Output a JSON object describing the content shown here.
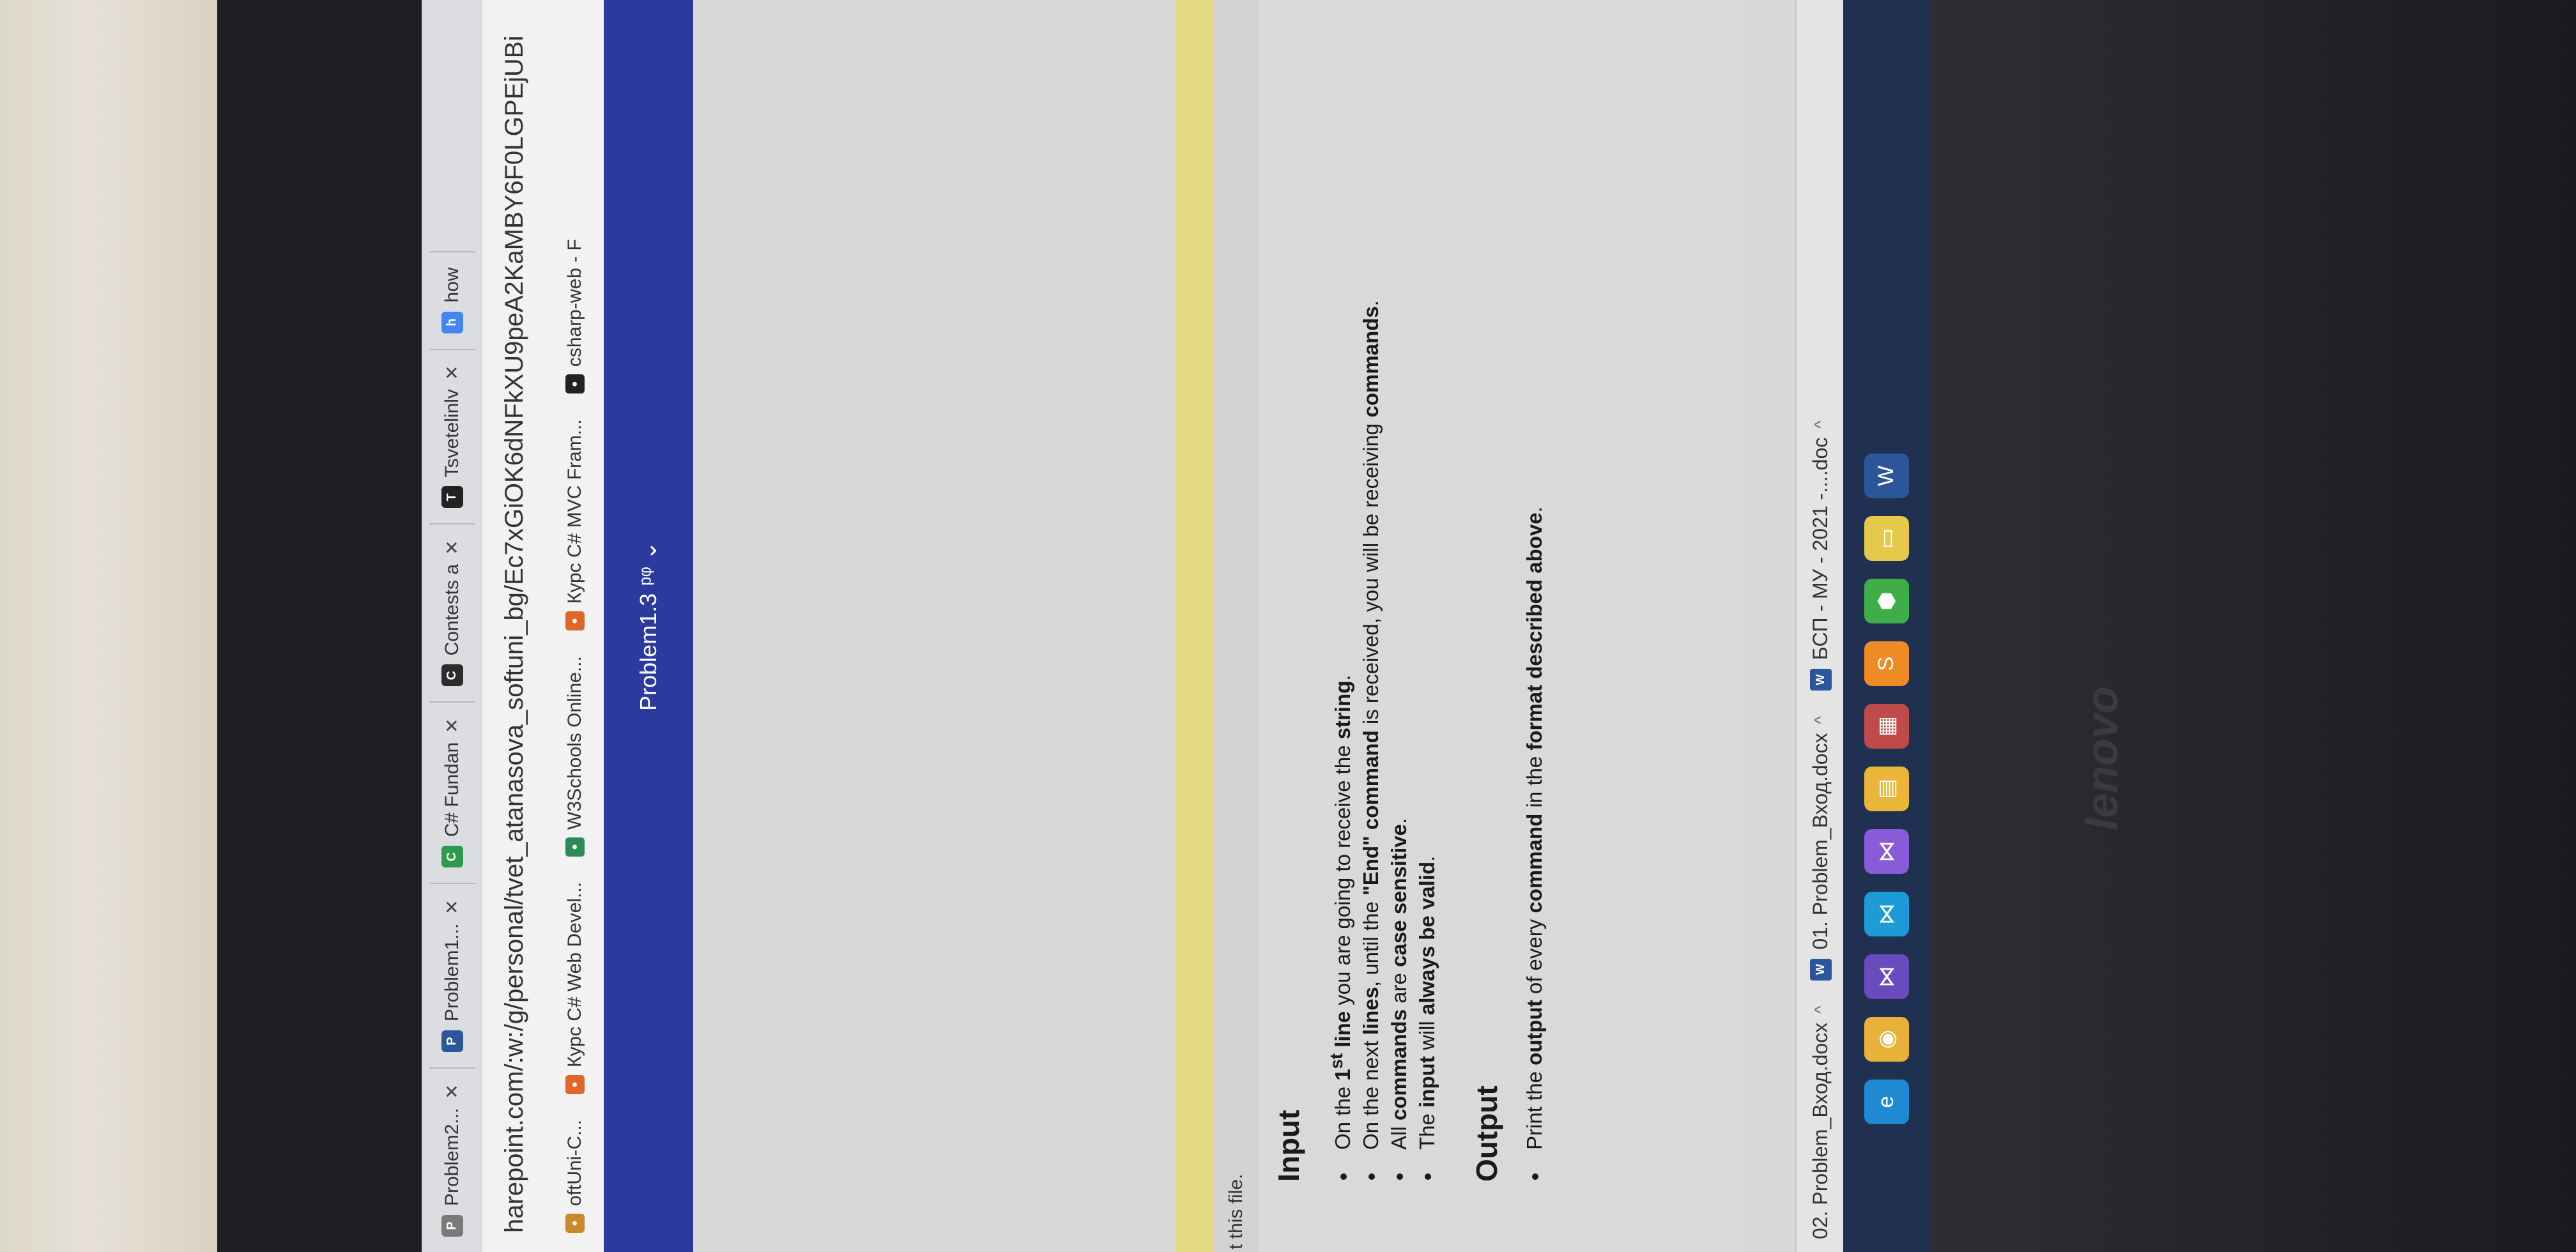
{
  "browser": {
    "tabs": [
      {
        "label": "Problem2...",
        "icon": "document-icon",
        "color": "#7a7a7a"
      },
      {
        "label": "Problem1...",
        "icon": "word-icon",
        "color": "#2b579a"
      },
      {
        "label": "C# Fundan",
        "icon": "softuni-icon",
        "color": "#2e9b4a"
      },
      {
        "label": "Contests a",
        "icon": "judge-icon",
        "color": "#2c2c2c"
      },
      {
        "label": "Tsvetelinlv",
        "icon": "github-icon",
        "color": "#222222"
      },
      {
        "label": "how",
        "icon": "google-icon",
        "color": "#4285f4"
      }
    ],
    "tab_close": "✕",
    "address": "harepoint.com/:w:/g/personal/tvet_atanasova_softuni_bg/Ec7xGiOK6dNFkXU9peA2KaMBY6F0LGPEjUBi",
    "bookmarks": [
      {
        "label": "oftUni-C...",
        "icon": "folder-icon",
        "color": "#c98a2b"
      },
      {
        "label": "Курс C# Web Devel...",
        "icon": "softuni-icon",
        "color": "#e0672a"
      },
      {
        "label": "W3Schools Online...",
        "icon": "w3schools-icon",
        "color": "#2e8b57"
      },
      {
        "label": "Курс C# MVC Fram...",
        "icon": "softuni-icon",
        "color": "#e0672a"
      },
      {
        "label": "csharp-web - F",
        "icon": "github-icon",
        "color": "#222222"
      }
    ]
  },
  "word": {
    "doc_title": "Problem1.3",
    "title_suffix": "ᵖᵠ ⌄"
  },
  "document": {
    "partial_line": "t this file.",
    "input_heading": "Input",
    "input_items": [
      "On the 1st line you are going to receive the string.",
      "On the next lines, until the \"End\" command is received, you will be receiving commands.",
      "All commands are case sensitive.",
      "The input will always be valid."
    ],
    "output_heading": "Output",
    "output_items": [
      "Print the output of every command in the format described above."
    ]
  },
  "downloads": [
    {
      "label": "02. Problem_Вход.docx",
      "chevron": "^"
    },
    {
      "label": "01. Problem_Вход.docx",
      "chevron": "^"
    },
    {
      "label": "БСП - МУ - 2021 -....doc",
      "chevron": "^"
    }
  ],
  "taskbar": {
    "icons": [
      {
        "name": "edge-icon",
        "color": "#1f8ad2",
        "glyph": "e"
      },
      {
        "name": "chrome-icon",
        "color": "#e8b23a",
        "glyph": "◉"
      },
      {
        "name": "visual-studio-icon",
        "color": "#6a4bbd",
        "glyph": "⋈"
      },
      {
        "name": "vscode-icon",
        "color": "#1d9bd6",
        "glyph": "⋈"
      },
      {
        "name": "visual-studio-preview-icon",
        "color": "#8a5bd6",
        "glyph": "⋈"
      },
      {
        "name": "file-explorer-icon",
        "color": "#e9b637",
        "glyph": "▤"
      },
      {
        "name": "calendar-icon",
        "color": "#c04a4a",
        "glyph": "▦"
      },
      {
        "name": "sublime-icon",
        "color": "#f08a24",
        "glyph": "S"
      },
      {
        "name": "app-green-icon",
        "color": "#3fae49",
        "glyph": "⬢"
      },
      {
        "name": "sticky-notes-icon",
        "color": "#e4c94a",
        "glyph": "▭"
      },
      {
        "name": "word-icon",
        "color": "#2b579a",
        "glyph": "W"
      }
    ]
  },
  "laptop": {
    "brand": "lenovo"
  }
}
